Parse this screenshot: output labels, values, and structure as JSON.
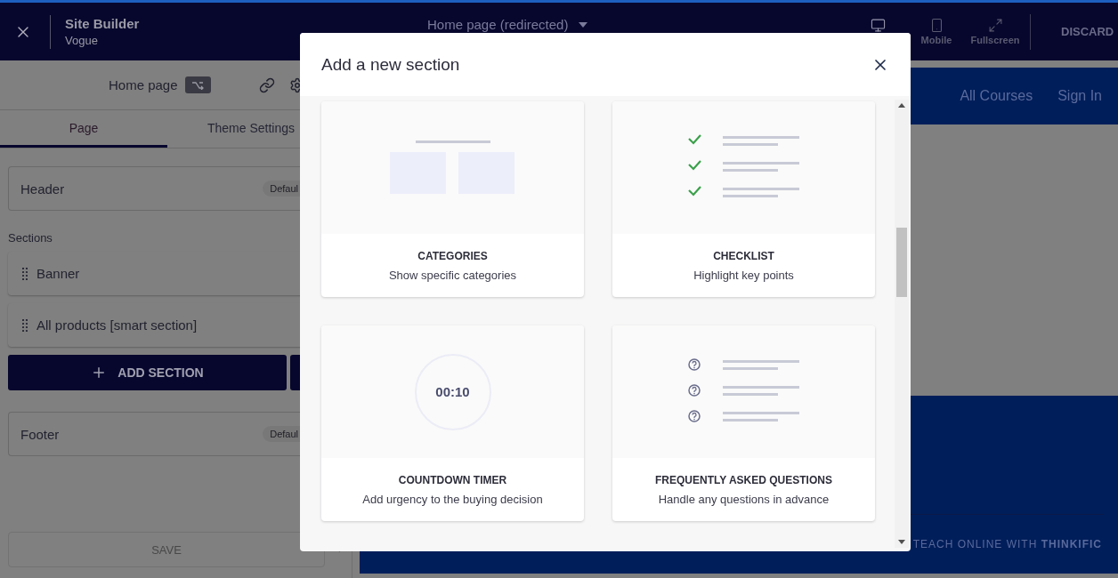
{
  "top_bar": {
    "title": "Site Builder",
    "subtitle": "Vogue",
    "page_selector": "Home page (redirected)",
    "view_modes": [
      {
        "kind": "desktop",
        "selected": true
      },
      {
        "kind": "mobile",
        "label": "Mobile",
        "selected": false
      },
      {
        "kind": "fullscreen",
        "label": "Fullscreen",
        "selected": false
      }
    ],
    "discard": "DISCARD"
  },
  "sidebar": {
    "page_name": "Home page",
    "tabs": [
      {
        "label": "Page",
        "selected": true
      },
      {
        "label": "Theme Settings",
        "selected": false
      }
    ],
    "header": {
      "label": "Header",
      "badge": "Defaul"
    },
    "sections_label": "Sections",
    "sections": [
      "Banner",
      "All products [smart section]"
    ],
    "add_button": "ADD SECTION",
    "footer": {
      "label": "Footer",
      "badge": "Defaul"
    },
    "save_button": {
      "label": "SAVE",
      "disabled": true
    }
  },
  "preview": {
    "nav_links": [
      "All Courses",
      "Sign In"
    ],
    "footer_text": "TEACH ONLINE WITH **THINKIFIC**"
  },
  "modal": {
    "title": "Add a new section",
    "cards": [
      {
        "kind": "categories",
        "title": "CATEGORIES",
        "description": "Show specific categories"
      },
      {
        "kind": "checklist",
        "title": "CHECKLIST",
        "description": "Highlight key points"
      },
      {
        "kind": "countdown",
        "title": "COUNTDOWN TIMER",
        "description": "Add urgency to the buying decision",
        "timer": "00:10"
      },
      {
        "kind": "faq",
        "title": "FREQUENTLY ASKED QUESTIONS",
        "description": "Handle any questions in advance"
      }
    ]
  }
}
